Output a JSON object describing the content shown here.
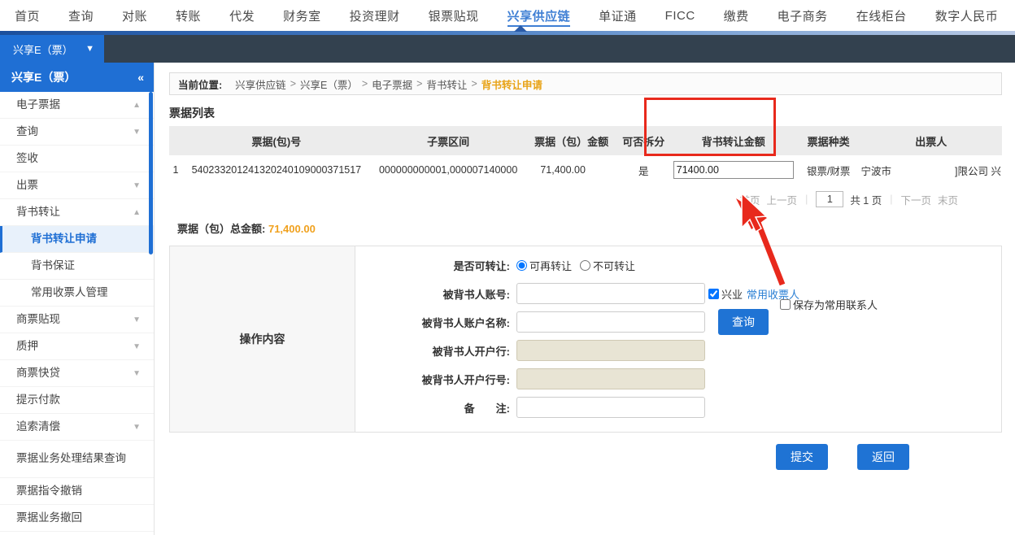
{
  "topnav": {
    "items": [
      {
        "label": "首页",
        "active": false
      },
      {
        "label": "查询",
        "active": false
      },
      {
        "label": "对账",
        "active": false
      },
      {
        "label": "转账",
        "active": false
      },
      {
        "label": "代发",
        "active": false
      },
      {
        "label": "财务室",
        "active": false
      },
      {
        "label": "投资理财",
        "active": false
      },
      {
        "label": "银票贴现",
        "active": false
      },
      {
        "label": "兴享供应链",
        "active": true
      },
      {
        "label": "单证通",
        "active": false
      },
      {
        "label": "FICC",
        "active": false
      },
      {
        "label": "缴费",
        "active": false
      },
      {
        "label": "电子商务",
        "active": false
      },
      {
        "label": "在线柜台",
        "active": false
      },
      {
        "label": "数字人民币",
        "active": false
      }
    ]
  },
  "subbar": {
    "tab_label": "兴享E（票）",
    "caret": "chevron-down-icon"
  },
  "sidebar": {
    "header": "兴享E（票）",
    "collapse_icon": "«",
    "items": [
      {
        "label": "电子票据",
        "level": 1,
        "chevron": "up",
        "active": false
      },
      {
        "label": "查询",
        "level": 1,
        "chevron": "down",
        "active": false
      },
      {
        "label": "签收",
        "level": 1,
        "chevron": "",
        "active": false
      },
      {
        "label": "出票",
        "level": 1,
        "chevron": "down",
        "active": false
      },
      {
        "label": "背书转让",
        "level": 1,
        "chevron": "up",
        "active": false
      },
      {
        "label": "背书转让申请",
        "level": 2,
        "chevron": "",
        "active": true
      },
      {
        "label": "背书保证",
        "level": 2,
        "chevron": "",
        "active": false
      },
      {
        "label": "常用收票人管理",
        "level": 2,
        "chevron": "",
        "active": false
      },
      {
        "label": "商票贴现",
        "level": 1,
        "chevron": "down",
        "active": false
      },
      {
        "label": "质押",
        "level": 1,
        "chevron": "down",
        "active": false
      },
      {
        "label": "商票快贷",
        "level": 1,
        "chevron": "down",
        "active": false
      },
      {
        "label": "提示付款",
        "level": 1,
        "chevron": "",
        "active": false
      },
      {
        "label": "追索清偿",
        "level": 1,
        "chevron": "down",
        "active": false
      },
      {
        "label": "票据业务处理结果查询",
        "level": 1,
        "chevron": "",
        "active": false,
        "two_line": true
      },
      {
        "label": "票据指令撤销",
        "level": 1,
        "chevron": "",
        "active": false
      },
      {
        "label": "票据业务撤回",
        "level": 1,
        "chevron": "",
        "active": false
      }
    ]
  },
  "breadcrumb": {
    "label": "当前位置:",
    "segments": [
      "兴享供应链",
      "兴享E（票）",
      "电子票据",
      "背书转让"
    ],
    "separator": ">",
    "current": "背书转让申请"
  },
  "list": {
    "title": "票据列表",
    "columns": [
      "票据(包)号",
      "子票区间",
      "票据（包）金额",
      "可否拆分",
      "背书转让金额",
      "票据种类",
      "出票人"
    ],
    "rows": [
      {
        "index": "1",
        "bill_no": "540233201241320240109000371517",
        "sub_range": "000000000001,000007140000",
        "amount": "71,400.00",
        "splittable": "是",
        "transfer_amount": "71400.00",
        "bill_type": "银票/财票",
        "drawer_prefix": "宁波市",
        "drawer_suffix": "]限公司",
        "drawer_tail": "兴"
      }
    ],
    "total_label": "票据（包）总金额:",
    "total_value": "71,400.00"
  },
  "pager": {
    "first": "首页",
    "prev": "上一页",
    "page_value": "1",
    "total_pages": "共 1 页",
    "next": "下一页",
    "last": "末页"
  },
  "form": {
    "panel_title": "操作内容",
    "transferable_label": "是否可转让:",
    "transferable_options": [
      {
        "label": "可再转让",
        "checked": true
      },
      {
        "label": "不可转让",
        "checked": false
      }
    ],
    "endorsee_account_label": "被背书人账号:",
    "endorsee_account_value": "",
    "bank_checkbox_label": "兴业",
    "bank_checkbox_checked": true,
    "frequent_payee_link": "常用收票人",
    "endorsee_name_label": "被背书人账户名称:",
    "endorsee_name_value": "",
    "query_button": "查询",
    "save_contact_label": "保存为常用联系人",
    "save_contact_checked": false,
    "endorsee_bank_label": "被背书人开户行:",
    "endorsee_bank_value": "",
    "endorsee_bank_code_label": "被背书人开户行号:",
    "endorsee_bank_code_value": "",
    "remark_label": "备　　注:",
    "remark_value": ""
  },
  "actions": {
    "submit": "提交",
    "back": "返回"
  },
  "colors": {
    "accent": "#1f6fd4",
    "highlight_box": "#e8291c",
    "breadcrumb_current": "#e8a317",
    "total_value": "#f0a11e",
    "subbar_bg": "#33414f"
  }
}
